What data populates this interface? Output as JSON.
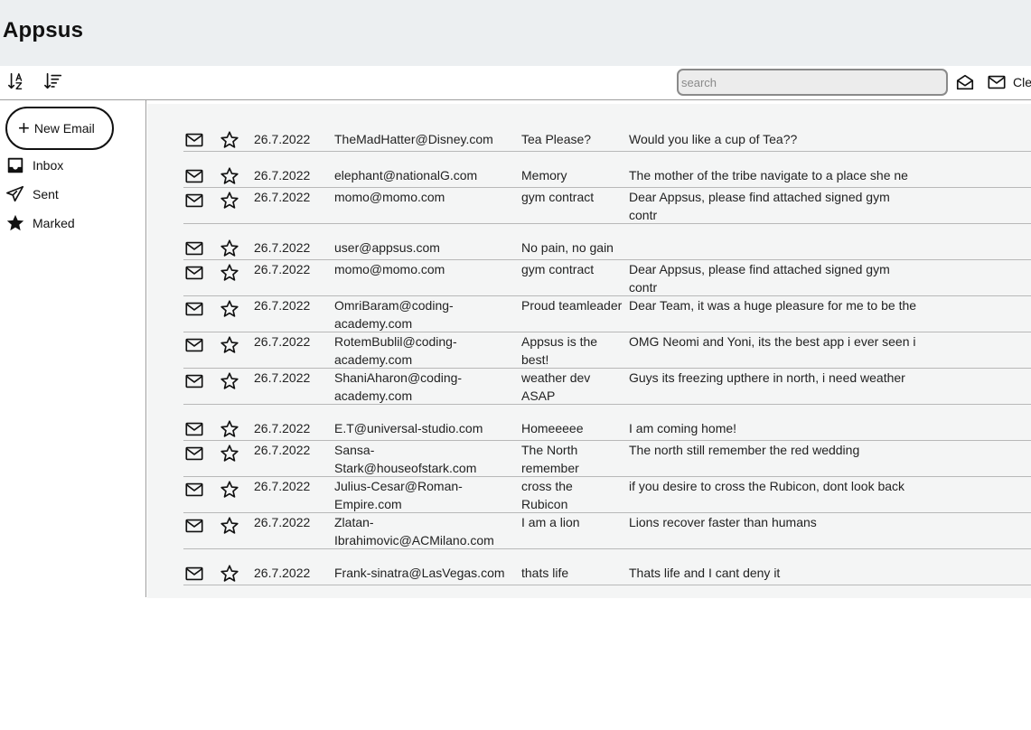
{
  "app": {
    "title": "Appsus"
  },
  "toolbar": {
    "sort_alpha_icon": "sort-alpha-icon",
    "sort_date_icon": "sort-desc-icon",
    "search_placeholder": "search",
    "search_value": "",
    "read_filter_icon": "envelope-open-icon",
    "unread_filter_icon": "envelope-icon",
    "clear_label": "Clear"
  },
  "sidebar": {
    "compose_label": "New Email",
    "items": [
      {
        "label": "Inbox",
        "icon": "inbox-icon"
      },
      {
        "label": "Sent",
        "icon": "send-icon"
      },
      {
        "label": "Marked",
        "icon": "star-icon"
      }
    ]
  },
  "emails": [
    {
      "date": "26.7.2022",
      "from": "TheMadHatter@Disney.com",
      "subject": "Tea Please?",
      "body": "Would you like a cup of Tea??"
    },
    {
      "date": "26.7.2022",
      "from": "elephant@nationalG.com",
      "subject": "Memory",
      "body": "The mother of the tribe navigate to a place she ne"
    },
    {
      "date": "26.7.2022",
      "from": "momo@momo.com",
      "subject": "gym contract",
      "body": "Dear Appsus, please find attached signed gym contr"
    },
    {
      "date": "26.7.2022",
      "from": "user@appsus.com",
      "subject": "No pain, no gain",
      "body": ""
    },
    {
      "date": "26.7.2022",
      "from": "momo@momo.com",
      "subject": "gym contract",
      "body": "Dear Appsus, please find attached signed gym contr"
    },
    {
      "date": "26.7.2022",
      "from": "OmriBaram@coding-academy.com",
      "subject": "Proud teamleader",
      "body": "Dear Team, it was a huge pleasure for me to be the"
    },
    {
      "date": "26.7.2022",
      "from": "RotemBublil@coding-academy.com",
      "subject": "Appsus is the best!",
      "body": "OMG Neomi and Yoni, its the best app i ever seen i"
    },
    {
      "date": "26.7.2022",
      "from": "ShaniAharon@coding-academy.com",
      "subject": "weather dev ASAP",
      "body": "Guys its freezing upthere in north, i need weather"
    },
    {
      "date": "26.7.2022",
      "from": "E.T@universal-studio.com",
      "subject": "Homeeeee",
      "body": "I am coming home!"
    },
    {
      "date": "26.7.2022",
      "from": "Sansa-Stark@houseofstark.com",
      "subject": "The North remember",
      "body": "The north still remember the red wedding"
    },
    {
      "date": "26.7.2022",
      "from": "Julius-Cesar@Roman-Empire.com",
      "subject": "cross the Rubicon",
      "body": "if you desire to cross the Rubicon, dont look back"
    },
    {
      "date": "26.7.2022",
      "from": "Zlatan-Ibrahimovic@ACMilano.com",
      "subject": "I am a lion",
      "body": "Lions recover faster than humans"
    },
    {
      "date": "26.7.2022",
      "from": "Frank-sinatra@LasVegas.com",
      "subject": "thats life",
      "body": "Thats life and I cant deny it"
    }
  ]
}
